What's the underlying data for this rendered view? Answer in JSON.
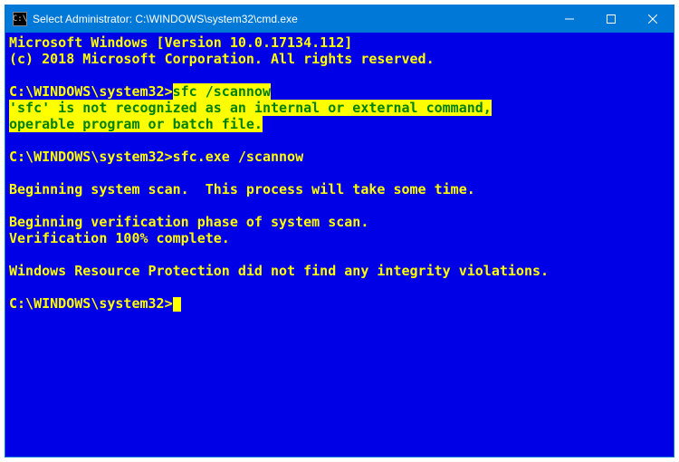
{
  "titlebar": {
    "icon_glyph": "C:\\",
    "title": "Select Administrator: C:\\WINDOWS\\system32\\cmd.exe"
  },
  "console": {
    "prompt": "C:\\WINDOWS\\system32>",
    "header1": "Microsoft Windows [Version 10.0.17134.112]",
    "header2": "(c) 2018 Microsoft Corporation. All rights reserved.",
    "cmd1": "sfc /scannow",
    "error1": "'sfc' is not recognized as an internal or external command,",
    "error2": "operable program or batch file.",
    "cmd2": "sfc.exe /scannow",
    "line_begin_scan": "Beginning system scan.  This process will take some time.",
    "line_verify": "Beginning verification phase of system scan.",
    "line_verify_pct": "Verification 100% complete.",
    "line_result": "Windows Resource Protection did not find any integrity violations."
  },
  "colors": {
    "titlebar_bg": "#0078d7",
    "console_bg": "#0000e6",
    "fg": "#ffff00",
    "highlight_bg": "#ffff00",
    "highlight_fg": "#008000"
  }
}
